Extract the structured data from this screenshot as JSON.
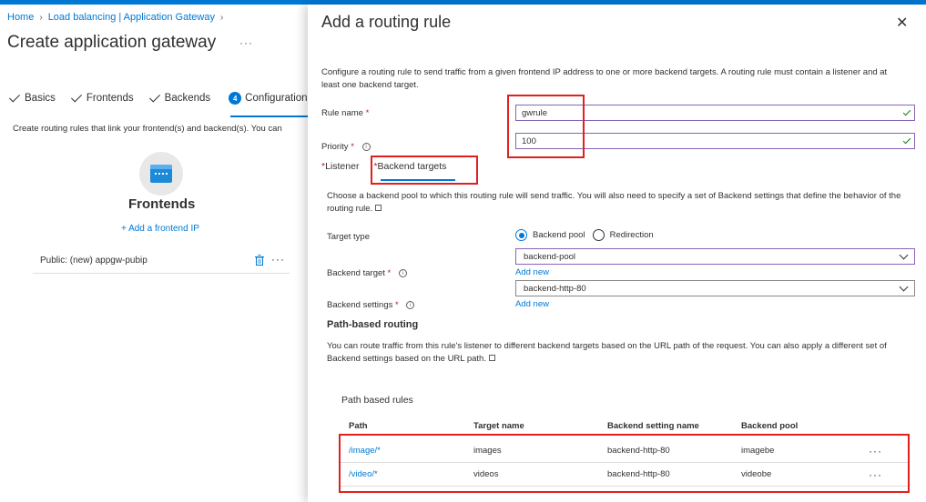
{
  "breadcrumb": [
    "Home",
    "Load balancing | Application Gateway"
  ],
  "page_title": "Create application gateway",
  "wizard_steps": [
    {
      "label": "Basics",
      "state": "done"
    },
    {
      "label": "Frontends",
      "state": "done"
    },
    {
      "label": "Backends",
      "state": "done"
    },
    {
      "label": "Configuration",
      "number": "4",
      "state": "active"
    }
  ],
  "left": {
    "description": "Create routing rules that link your frontend(s) and backend(s). You can",
    "frontends_title": "Frontends",
    "add_frontend": "+ Add a frontend IP",
    "frontend_item": "Public: (new) appgw-pubip",
    "more": "···"
  },
  "panel": {
    "title": "Add a routing rule",
    "description": "Configure a routing rule to send traffic from a given frontend IP address to one or more backend targets. A routing rule must contain a listener and at least one backend target.",
    "rule_name_label": "Rule name",
    "rule_name_value": "gwrule",
    "priority_label": "Priority",
    "priority_value": "100",
    "tabs": [
      {
        "label": "Listener",
        "required": true
      },
      {
        "label": "Backend targets",
        "required": true,
        "active": true
      }
    ],
    "backend_desc": "Choose a backend pool to which this routing rule will send traffic. You will also need to specify a set of Backend settings that define the behavior of the routing rule.",
    "target_type_label": "Target type",
    "target_type_options": [
      "Backend pool",
      "Redirection"
    ],
    "target_type_selected": "Backend pool",
    "backend_target_label": "Backend target",
    "backend_target_value": "backend-pool",
    "add_new": "Add new",
    "backend_settings_label": "Backend settings",
    "backend_settings_value": "backend-http-80",
    "path_routing_title": "Path-based routing",
    "path_routing_desc": "You can route traffic from this rule's listener to different backend targets based on the URL path of the request. You can also apply a different set of Backend settings based on the URL path.",
    "path_rules_title": "Path based rules",
    "table_headers": [
      "Path",
      "Target name",
      "Backend setting name",
      "Backend pool"
    ],
    "table_rows": [
      [
        "/image/*",
        "images",
        "backend-http-80",
        "imagebe"
      ],
      [
        "/video/*",
        "videos",
        "backend-http-80",
        "videobe"
      ]
    ],
    "row_more": "···"
  },
  "colors": {
    "accent": "#0078d4",
    "highlight": "#e02020",
    "valid": "#107c10"
  }
}
